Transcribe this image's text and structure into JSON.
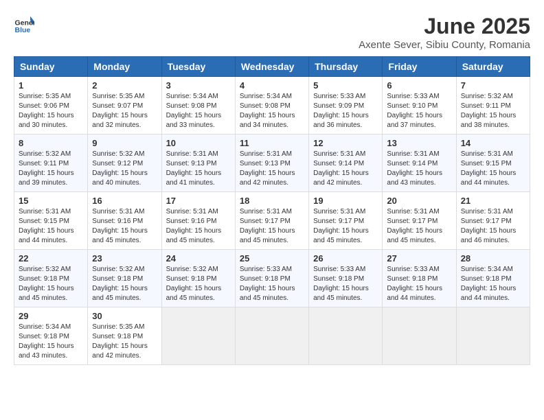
{
  "header": {
    "logo": {
      "text_general": "General",
      "text_blue": "Blue"
    },
    "title": "June 2025",
    "subtitle": "Axente Sever, Sibiu County, Romania"
  },
  "calendar": {
    "headers": [
      "Sunday",
      "Monday",
      "Tuesday",
      "Wednesday",
      "Thursday",
      "Friday",
      "Saturday"
    ],
    "rows": [
      [
        {
          "day": "1",
          "sunrise": "Sunrise: 5:35 AM",
          "sunset": "Sunset: 9:06 PM",
          "daylight": "Daylight: 15 hours and 30 minutes."
        },
        {
          "day": "2",
          "sunrise": "Sunrise: 5:35 AM",
          "sunset": "Sunset: 9:07 PM",
          "daylight": "Daylight: 15 hours and 32 minutes."
        },
        {
          "day": "3",
          "sunrise": "Sunrise: 5:34 AM",
          "sunset": "Sunset: 9:08 PM",
          "daylight": "Daylight: 15 hours and 33 minutes."
        },
        {
          "day": "4",
          "sunrise": "Sunrise: 5:34 AM",
          "sunset": "Sunset: 9:08 PM",
          "daylight": "Daylight: 15 hours and 34 minutes."
        },
        {
          "day": "5",
          "sunrise": "Sunrise: 5:33 AM",
          "sunset": "Sunset: 9:09 PM",
          "daylight": "Daylight: 15 hours and 36 minutes."
        },
        {
          "day": "6",
          "sunrise": "Sunrise: 5:33 AM",
          "sunset": "Sunset: 9:10 PM",
          "daylight": "Daylight: 15 hours and 37 minutes."
        },
        {
          "day": "7",
          "sunrise": "Sunrise: 5:32 AM",
          "sunset": "Sunset: 9:11 PM",
          "daylight": "Daylight: 15 hours and 38 minutes."
        }
      ],
      [
        {
          "day": "8",
          "sunrise": "Sunrise: 5:32 AM",
          "sunset": "Sunset: 9:11 PM",
          "daylight": "Daylight: 15 hours and 39 minutes."
        },
        {
          "day": "9",
          "sunrise": "Sunrise: 5:32 AM",
          "sunset": "Sunset: 9:12 PM",
          "daylight": "Daylight: 15 hours and 40 minutes."
        },
        {
          "day": "10",
          "sunrise": "Sunrise: 5:31 AM",
          "sunset": "Sunset: 9:13 PM",
          "daylight": "Daylight: 15 hours and 41 minutes."
        },
        {
          "day": "11",
          "sunrise": "Sunrise: 5:31 AM",
          "sunset": "Sunset: 9:13 PM",
          "daylight": "Daylight: 15 hours and 42 minutes."
        },
        {
          "day": "12",
          "sunrise": "Sunrise: 5:31 AM",
          "sunset": "Sunset: 9:14 PM",
          "daylight": "Daylight: 15 hours and 42 minutes."
        },
        {
          "day": "13",
          "sunrise": "Sunrise: 5:31 AM",
          "sunset": "Sunset: 9:14 PM",
          "daylight": "Daylight: 15 hours and 43 minutes."
        },
        {
          "day": "14",
          "sunrise": "Sunrise: 5:31 AM",
          "sunset": "Sunset: 9:15 PM",
          "daylight": "Daylight: 15 hours and 44 minutes."
        }
      ],
      [
        {
          "day": "15",
          "sunrise": "Sunrise: 5:31 AM",
          "sunset": "Sunset: 9:15 PM",
          "daylight": "Daylight: 15 hours and 44 minutes."
        },
        {
          "day": "16",
          "sunrise": "Sunrise: 5:31 AM",
          "sunset": "Sunset: 9:16 PM",
          "daylight": "Daylight: 15 hours and 45 minutes."
        },
        {
          "day": "17",
          "sunrise": "Sunrise: 5:31 AM",
          "sunset": "Sunset: 9:16 PM",
          "daylight": "Daylight: 15 hours and 45 minutes."
        },
        {
          "day": "18",
          "sunrise": "Sunrise: 5:31 AM",
          "sunset": "Sunset: 9:17 PM",
          "daylight": "Daylight: 15 hours and 45 minutes."
        },
        {
          "day": "19",
          "sunrise": "Sunrise: 5:31 AM",
          "sunset": "Sunset: 9:17 PM",
          "daylight": "Daylight: 15 hours and 45 minutes."
        },
        {
          "day": "20",
          "sunrise": "Sunrise: 5:31 AM",
          "sunset": "Sunset: 9:17 PM",
          "daylight": "Daylight: 15 hours and 45 minutes."
        },
        {
          "day": "21",
          "sunrise": "Sunrise: 5:31 AM",
          "sunset": "Sunset: 9:17 PM",
          "daylight": "Daylight: 15 hours and 46 minutes."
        }
      ],
      [
        {
          "day": "22",
          "sunrise": "Sunrise: 5:32 AM",
          "sunset": "Sunset: 9:18 PM",
          "daylight": "Daylight: 15 hours and 45 minutes."
        },
        {
          "day": "23",
          "sunrise": "Sunrise: 5:32 AM",
          "sunset": "Sunset: 9:18 PM",
          "daylight": "Daylight: 15 hours and 45 minutes."
        },
        {
          "day": "24",
          "sunrise": "Sunrise: 5:32 AM",
          "sunset": "Sunset: 9:18 PM",
          "daylight": "Daylight: 15 hours and 45 minutes."
        },
        {
          "day": "25",
          "sunrise": "Sunrise: 5:33 AM",
          "sunset": "Sunset: 9:18 PM",
          "daylight": "Daylight: 15 hours and 45 minutes."
        },
        {
          "day": "26",
          "sunrise": "Sunrise: 5:33 AM",
          "sunset": "Sunset: 9:18 PM",
          "daylight": "Daylight: 15 hours and 45 minutes."
        },
        {
          "day": "27",
          "sunrise": "Sunrise: 5:33 AM",
          "sunset": "Sunset: 9:18 PM",
          "daylight": "Daylight: 15 hours and 44 minutes."
        },
        {
          "day": "28",
          "sunrise": "Sunrise: 5:34 AM",
          "sunset": "Sunset: 9:18 PM",
          "daylight": "Daylight: 15 hours and 44 minutes."
        }
      ],
      [
        {
          "day": "29",
          "sunrise": "Sunrise: 5:34 AM",
          "sunset": "Sunset: 9:18 PM",
          "daylight": "Daylight: 15 hours and 43 minutes."
        },
        {
          "day": "30",
          "sunrise": "Sunrise: 5:35 AM",
          "sunset": "Sunset: 9:18 PM",
          "daylight": "Daylight: 15 hours and 42 minutes."
        },
        null,
        null,
        null,
        null,
        null
      ]
    ]
  }
}
